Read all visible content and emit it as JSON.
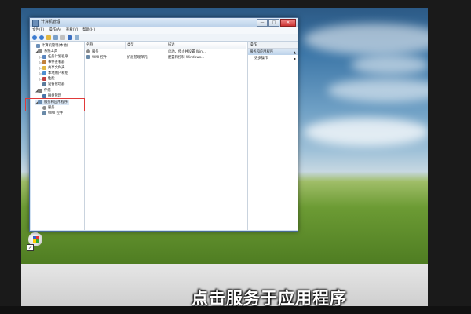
{
  "caption": "点击服务于应用程序",
  "window": {
    "title": "计算机管理",
    "menu": [
      "文件(F)",
      "操作(A)",
      "查看(V)",
      "帮助(H)"
    ],
    "controls": {
      "minimize": "—",
      "maximize": "□",
      "close": "✕"
    }
  },
  "tree": {
    "items": [
      {
        "label": "计算机管理(本地)",
        "arrow": "",
        "icon": "computer-icon",
        "color": "#6b8fb8"
      },
      {
        "label": "系统工具",
        "arrow": "◢",
        "icon": "tools-icon",
        "color": "#8a8a8a"
      },
      {
        "label": "任务计划程序",
        "arrow": "▷",
        "icon": "clock-icon",
        "color": "#5a86c0"
      },
      {
        "label": "事件查看器",
        "arrow": "▷",
        "icon": "log-icon",
        "color": "#c0803a"
      },
      {
        "label": "共享文件夹",
        "arrow": "▷",
        "icon": "folder-icon",
        "color": "#e0b640"
      },
      {
        "label": "本地用户和组",
        "arrow": "▷",
        "icon": "users-icon",
        "color": "#4f8fd0"
      },
      {
        "label": "性能",
        "arrow": "▷",
        "icon": "performance-icon",
        "color": "#c04040"
      },
      {
        "label": "设备管理器",
        "arrow": "",
        "icon": "device-icon",
        "color": "#5c7c9c"
      },
      {
        "label": "存储",
        "arrow": "◢",
        "icon": "storage-icon",
        "color": "#7a7a7a"
      },
      {
        "label": "磁盘管理",
        "arrow": "",
        "icon": "disk-icon",
        "color": "#4a74a8"
      },
      {
        "label": "服务和应用程序",
        "arrow": "◢",
        "icon": "services-icon",
        "color": "#6a8cb0",
        "selected": true
      },
      {
        "label": "服务",
        "arrow": "",
        "icon": "gear-icon",
        "color": "#8a8a8a"
      },
      {
        "label": "WMI 控件",
        "arrow": "",
        "icon": "wmi-icon",
        "color": "#6a8aa8"
      }
    ]
  },
  "list": {
    "columns": [
      "名称",
      "类型",
      "描述"
    ],
    "rows": [
      {
        "name": "服务",
        "type": "",
        "desc": "启动、停止并设置 Win..."
      },
      {
        "name": "WMI 控件",
        "type": "扩展管理单元",
        "desc": "配置和控制 Windows..."
      }
    ]
  },
  "actions": {
    "title": "操作",
    "section": "服务和应用程序",
    "items": [
      "更多操作"
    ]
  },
  "colors": {
    "highlight_box": "#e03a3a",
    "selection": "#3399ff"
  }
}
